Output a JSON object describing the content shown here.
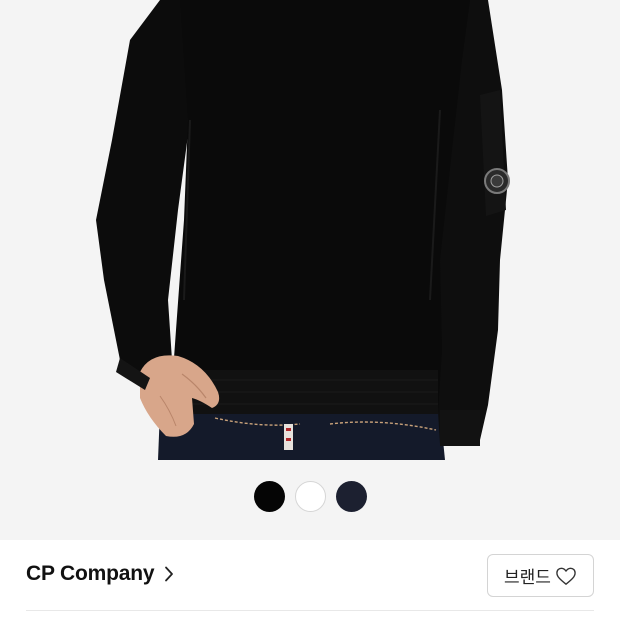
{
  "product": {
    "image_icon": "black-crewneck-sweater-photo",
    "color_options": [
      {
        "name": "black",
        "color": "#050505",
        "selected": true
      },
      {
        "name": "white",
        "color": "#ffffff",
        "selected": false
      },
      {
        "name": "navy",
        "color": "#1c2030",
        "selected": false
      }
    ]
  },
  "brand": {
    "name": "CP Company",
    "chevron_icon": "chevron-right-icon",
    "follow_label": "브랜드",
    "follow_icon": "heart-outline-icon"
  },
  "colors": {
    "gallery_background": "#f4f4f4",
    "garment": "#0b0b0b",
    "text": "#111111",
    "border": "#d4d4d4"
  }
}
